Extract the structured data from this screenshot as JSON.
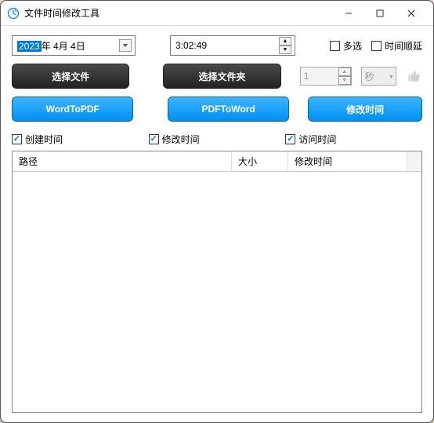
{
  "window": {
    "title": "文件时间修改工具"
  },
  "date": {
    "year": "2023",
    "rest": "年 4月 4日"
  },
  "time": {
    "value": "3:02:49"
  },
  "options": {
    "multi": "多选",
    "delay": "时间顺延"
  },
  "delay_num": {
    "value": "1",
    "unit": "秒"
  },
  "buttons": {
    "select_file": "选择文件",
    "select_folder": "选择文件夹",
    "word_to_pdf": "WordToPDF",
    "pdf_to_word": "PDFToWord",
    "modify": "修改时间"
  },
  "checks": {
    "create": "创建时间",
    "modify": "修改时间",
    "access": "访问时间"
  },
  "table": {
    "headers": {
      "path": "路径",
      "size": "大小",
      "mtime": "修改时间"
    }
  }
}
